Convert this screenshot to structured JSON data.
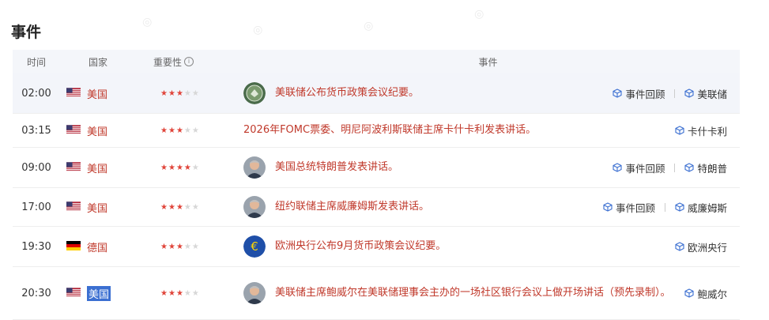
{
  "page": {
    "title": "事件"
  },
  "header": {
    "time": "时间",
    "country": "国家",
    "importance": "重要性",
    "event": "事件",
    "info_glyph": "i"
  },
  "icons": {
    "star": "★",
    "cube": "cube-icon"
  },
  "colors": {
    "accent_red": "#c0392b",
    "star_on": "#e0443a",
    "star_off": "#d7d7d7",
    "link_blue": "#3b6fd1"
  },
  "rows": [
    {
      "time": "02:00",
      "country": "美国",
      "flag": "us",
      "stars": 3,
      "avatar": "fed-seal",
      "event": "美联储公布货币政策会议纪要。",
      "actions": [
        "事件回顾",
        "美联储"
      ]
    },
    {
      "time": "03:15",
      "country": "美国",
      "flag": "us",
      "stars": 3,
      "avatar": "",
      "event": "2026年FOMC票委、明尼阿波利斯联储主席卡什卡利发表讲话。",
      "actions": [
        "卡什卡利"
      ]
    },
    {
      "time": "09:00",
      "country": "美国",
      "flag": "us",
      "stars": 4,
      "avatar": "person",
      "event": "美国总统特朗普发表讲话。",
      "actions": [
        "事件回顾",
        "特朗普"
      ]
    },
    {
      "time": "17:00",
      "country": "美国",
      "flag": "us",
      "stars": 3,
      "avatar": "person",
      "event": "纽约联储主席威廉姆斯发表讲话。",
      "actions": [
        "事件回顾",
        "威廉姆斯"
      ]
    },
    {
      "time": "19:30",
      "country": "德国",
      "flag": "de",
      "stars": 3,
      "avatar": "euro",
      "event": "欧洲央行公布9月货币政策会议纪要。",
      "actions": [
        "欧洲央行"
      ]
    },
    {
      "time": "20:30",
      "country": "美国",
      "flag": "us",
      "stars": 3,
      "avatar": "person",
      "event": "美联储主席鲍威尔在美联储理事会主办的一场社区银行会议上做开场讲话（预先录制）。",
      "actions": [
        "鲍威尔"
      ],
      "country_highlight": true
    }
  ]
}
